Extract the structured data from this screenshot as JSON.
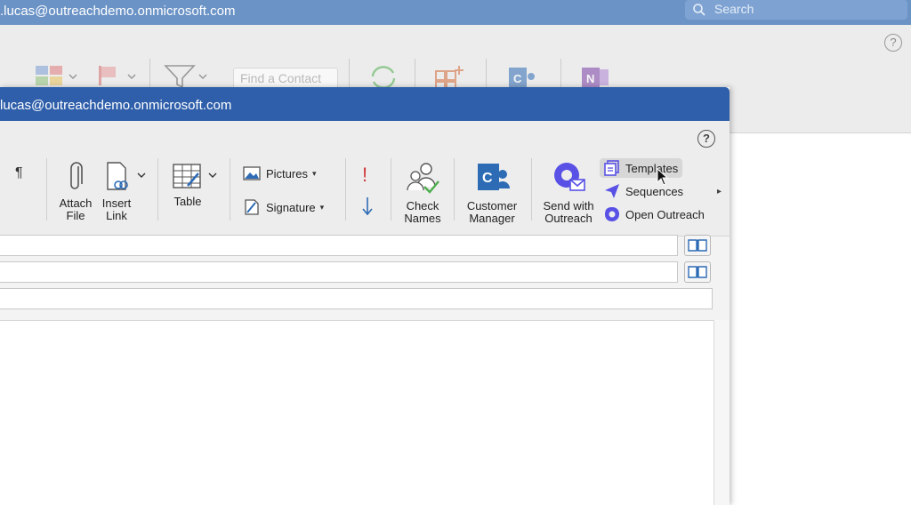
{
  "background_window": {
    "title": ".lucas@outreachdemo.onmicrosoft.com",
    "search_placeholder": "Search",
    "find_contact_placeholder": "Find a Contact",
    "help_label": "?"
  },
  "compose_window": {
    "title": "lucas@outreachdemo.onmicrosoft.com",
    "help_label": "?",
    "ribbon": {
      "pilcrow": "¶",
      "attach_file": [
        "Attach",
        "File"
      ],
      "insert_link": [
        "Insert",
        "Link"
      ],
      "table": "Table",
      "pictures": "Pictures",
      "signature": "Signature",
      "importance_high": "!",
      "check_names": [
        "Check",
        "Names"
      ],
      "customer_manager": [
        "Customer",
        "Manager"
      ],
      "send_with_outreach": [
        "Send with",
        "Outreach"
      ],
      "templates": "Templates",
      "sequences": "Sequences",
      "open_outreach": "Open Outreach",
      "overflow": "▸"
    }
  },
  "colors": {
    "bg_titlebar": "#6b93c6",
    "compose_titlebar": "#2f5faa",
    "outreach_purple": "#5951e6",
    "office_blue": "#2d6bb5"
  }
}
